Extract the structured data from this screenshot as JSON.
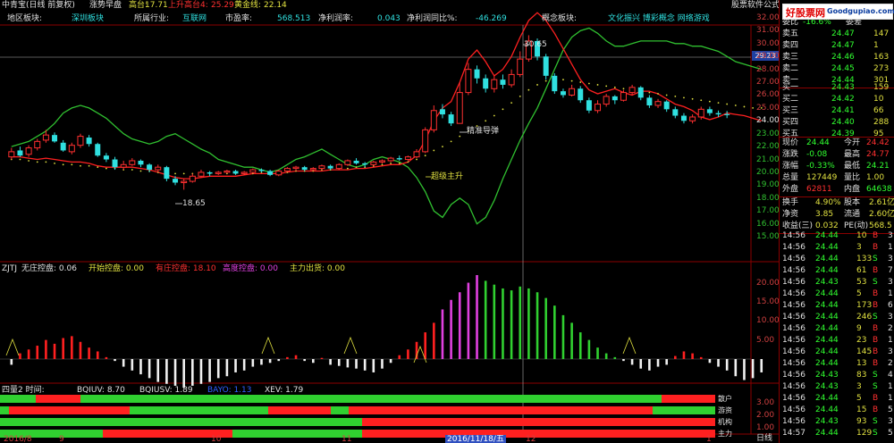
{
  "title_bar": {
    "name": "中青宝(日线 前复权)",
    "indicator": "涨势早盘",
    "gao_label": "高台:",
    "gao_value": "17.71",
    "up_label": "上升高台4:",
    "up_value": "25.29",
    "gold_label": "黄金线:",
    "gold_value": "22.14",
    "right_text": "股票软件公式"
  },
  "info_bar": {
    "region_label": "地区板块:",
    "region_value": "深圳板块",
    "industry_label": "所属行业:",
    "industry_value": "互联网",
    "pe_label": "市盈率:",
    "pe_value": "568.513",
    "margin_label": "净利润率:",
    "margin_value": "0.043",
    "growth_label": "净利润同比%:",
    "growth_value": "-46.269",
    "concept_label": "概念板块:",
    "concept_values": "文化振兴 博彩概念 网络游戏"
  },
  "main_chart": {
    "price_axis": [
      "32.00",
      "31.00",
      "30.00",
      "29.00",
      "28.00",
      "27.00",
      "26.00",
      "25.00",
      "24.00",
      "23.00",
      "22.00",
      "21.00",
      "20.00",
      "19.00",
      "18.00",
      "17.00",
      "16.00",
      "15.00"
    ],
    "annotations": {
      "high": "30.65",
      "low": "18.65",
      "precise": "精准导弹",
      "super": "超级主升"
    },
    "current_price_tag": "29.23"
  },
  "mid_indicator": {
    "label": "ZJTJ",
    "items": [
      {
        "label": "无庄控盘:",
        "value": "0.06",
        "color": "#e0e0e0"
      },
      {
        "label": "开始控盘:",
        "value": "0.00",
        "color": "#e0e040"
      },
      {
        "label": "有庄控盘:",
        "value": "18.10",
        "color": "#ff3030"
      },
      {
        "label": "高度控盘:",
        "value": "0.00",
        "color": "#e040e0"
      },
      {
        "label": "主力出货:",
        "value": "0.00",
        "color": "#e0e040"
      }
    ],
    "axis": [
      "20.00",
      "15.00",
      "10.00",
      "5.00"
    ]
  },
  "bottom_indicator": {
    "label": "四量2 时间:",
    "items": [
      {
        "label": "BQIUV:",
        "value": "8.70",
        "color": "#e0e0e0"
      },
      {
        "label": "BQIUSV:",
        "value": "1.89",
        "color": "#e0e0e0"
      },
      {
        "label": "BAYO:",
        "value": "1.13",
        "color": "#3060ff"
      },
      {
        "label": "XEV:",
        "value": "1.79",
        "color": "#e0e0e0"
      }
    ],
    "row_labels": [
      "散户",
      "游资",
      "机构",
      "主力"
    ],
    "axis": [
      "3.00",
      "2.00",
      "1.00"
    ]
  },
  "date_axis": {
    "labels": [
      "2016/8",
      "9",
      "10",
      "11",
      "2016/11/18/五",
      "12",
      "1"
    ],
    "corner": "日线"
  },
  "quote": {
    "header_label": "委比",
    "header_pct": "-16.6%",
    "header_diff": "委差",
    "sells": [
      {
        "label": "卖五",
        "price": "24.47",
        "vol": "147"
      },
      {
        "label": "卖四",
        "price": "24.47",
        "vol": "1"
      },
      {
        "label": "卖三",
        "price": "24.46",
        "vol": "163"
      },
      {
        "label": "卖二",
        "price": "24.45",
        "vol": "273"
      },
      {
        "label": "卖一",
        "price": "24.44",
        "vol": "301"
      }
    ],
    "buys": [
      {
        "label": "买一",
        "price": "24.43",
        "vol": "159"
      },
      {
        "label": "买二",
        "price": "24.42",
        "vol": "10"
      },
      {
        "label": "买三",
        "price": "24.41",
        "vol": "66"
      },
      {
        "label": "买四",
        "price": "24.40",
        "vol": "288"
      },
      {
        "label": "买五",
        "price": "24.39",
        "vol": "95"
      }
    ],
    "stats": [
      {
        "l1": "现价",
        "v1": "24.44",
        "l2": "今开",
        "v2": "24.42",
        "c1": "#30ff30",
        "c2": "#ff3030"
      },
      {
        "l1": "涨跌",
        "v1": "-0.08",
        "l2": "最高",
        "v2": "24.77",
        "c1": "#30ff30",
        "c2": "#ff3030"
      },
      {
        "l1": "涨幅",
        "v1": "-0.33%",
        "l2": "最低",
        "v2": "24.21",
        "c1": "#30ff30",
        "c2": "#30ff30"
      },
      {
        "l1": "总量",
        "v1": "127449",
        "l2": "量比",
        "v2": "1.00",
        "c1": "#e0e040",
        "c2": "#e0e040"
      },
      {
        "l1": "外盘",
        "v1": "62811",
        "l2": "内盘",
        "v2": "64638",
        "c1": "#ff3030",
        "c2": "#30ff30"
      }
    ],
    "stats2": [
      {
        "l1": "换手",
        "v1": "4.90%",
        "l2": "股本",
        "v2": "2.61亿"
      },
      {
        "l1": "净资",
        "v1": "3.85",
        "l2": "流通",
        "v2": "2.60亿"
      },
      {
        "l1": "收益(三)",
        "v1": "0.032",
        "l2": "PE(动)",
        "v2": "568.5"
      }
    ],
    "ticks": [
      {
        "time": "14:56",
        "price": "24.44",
        "vol": "10",
        "side": "B",
        "n": "3"
      },
      {
        "time": "14:56",
        "price": "24.44",
        "vol": "3",
        "side": "B",
        "n": "1"
      },
      {
        "time": "14:56",
        "price": "24.44",
        "vol": "133",
        "side": "S",
        "n": "3"
      },
      {
        "time": "14:56",
        "price": "24.44",
        "vol": "61",
        "side": "B",
        "n": "7"
      },
      {
        "time": "14:56",
        "price": "24.43",
        "vol": "53",
        "side": "S",
        "n": "3"
      },
      {
        "time": "14:56",
        "price": "24.44",
        "vol": "5",
        "side": "B",
        "n": "1"
      },
      {
        "time": "14:56",
        "price": "24.44",
        "vol": "173",
        "side": "B",
        "n": "6"
      },
      {
        "time": "14:56",
        "price": "24.44",
        "vol": "246",
        "side": "S",
        "n": "3"
      },
      {
        "time": "14:56",
        "price": "24.44",
        "vol": "9",
        "side": "B",
        "n": "2"
      },
      {
        "time": "14:56",
        "price": "24.44",
        "vol": "23",
        "side": "B",
        "n": "1"
      },
      {
        "time": "14:56",
        "price": "24.44",
        "vol": "145",
        "side": "B",
        "n": "3"
      },
      {
        "time": "14:56",
        "price": "24.44",
        "vol": "13",
        "side": "B",
        "n": "2"
      },
      {
        "time": "14:56",
        "price": "24.43",
        "vol": "83",
        "side": "S",
        "n": "4"
      },
      {
        "time": "14:56",
        "price": "24.43",
        "vol": "3",
        "side": "S",
        "n": "1"
      },
      {
        "time": "14:56",
        "price": "24.44",
        "vol": "5",
        "side": "B",
        "n": "1"
      },
      {
        "time": "14:56",
        "price": "24.44",
        "vol": "15",
        "side": "B",
        "n": "5"
      },
      {
        "time": "14:56",
        "price": "24.43",
        "vol": "93",
        "side": "S",
        "n": "3"
      },
      {
        "time": "14:57",
        "price": "24.44",
        "vol": "129",
        "side": "S",
        "n": "5"
      }
    ]
  },
  "logo": {
    "brand": "好股票网",
    "domain": "Goodgupiao.com"
  },
  "colors": {
    "up": "#ff3030",
    "down": "#30e0e0",
    "green": "#30c030",
    "yellow": "#e0e040",
    "magenta": "#e040e0"
  },
  "kline_series": {
    "candles": [
      {
        "o": 21.2,
        "c": 21.6,
        "h": 21.9,
        "l": 21.0
      },
      {
        "o": 21.7,
        "c": 21.3,
        "h": 22.0,
        "l": 21.2
      },
      {
        "o": 21.4,
        "c": 21.9,
        "h": 22.1,
        "l": 21.2
      },
      {
        "o": 21.9,
        "c": 22.4,
        "h": 22.6,
        "l": 21.7
      },
      {
        "o": 22.5,
        "c": 22.9,
        "h": 23.3,
        "l": 22.3
      },
      {
        "o": 22.9,
        "c": 22.4,
        "h": 23.1,
        "l": 22.3
      },
      {
        "o": 22.3,
        "c": 21.7,
        "h": 22.5,
        "l": 21.6
      },
      {
        "o": 21.6,
        "c": 22.1,
        "h": 22.3,
        "l": 21.4
      },
      {
        "o": 22.1,
        "c": 22.8,
        "h": 23.0,
        "l": 21.9
      },
      {
        "o": 22.7,
        "c": 22.2,
        "h": 22.9,
        "l": 22.0
      },
      {
        "o": 22.2,
        "c": 21.3,
        "h": 22.3,
        "l": 21.2
      },
      {
        "o": 21.3,
        "c": 21.0,
        "h": 21.5,
        "l": 20.8
      },
      {
        "o": 21.0,
        "c": 20.4,
        "h": 21.2,
        "l": 20.2
      },
      {
        "o": 20.4,
        "c": 20.6,
        "h": 20.9,
        "l": 20.2
      },
      {
        "o": 20.6,
        "c": 20.9,
        "h": 21.1,
        "l": 20.5
      },
      {
        "o": 20.9,
        "c": 20.6,
        "h": 21.0,
        "l": 20.4
      },
      {
        "o": 20.6,
        "c": 20.2,
        "h": 20.7,
        "l": 20.0
      },
      {
        "o": 20.2,
        "c": 20.4,
        "h": 20.6,
        "l": 20.0
      },
      {
        "o": 20.4,
        "c": 19.5,
        "h": 20.5,
        "l": 19.3
      },
      {
        "o": 19.5,
        "c": 19.2,
        "h": 19.7,
        "l": 19.0
      },
      {
        "o": 19.2,
        "c": 19.3,
        "h": 19.5,
        "l": 18.65
      },
      {
        "o": 19.3,
        "c": 19.7,
        "h": 19.9,
        "l": 19.2
      },
      {
        "o": 19.7,
        "c": 20.0,
        "h": 20.2,
        "l": 19.6
      },
      {
        "o": 20.0,
        "c": 19.9,
        "h": 20.1,
        "l": 19.7
      },
      {
        "o": 19.9,
        "c": 20.0,
        "h": 20.1,
        "l": 19.8
      },
      {
        "o": 20.0,
        "c": 20.1,
        "h": 20.2,
        "l": 19.9
      },
      {
        "o": 20.1,
        "c": 19.9,
        "h": 20.2,
        "l": 19.8
      },
      {
        "o": 19.9,
        "c": 20.0,
        "h": 20.1,
        "l": 19.8
      },
      {
        "o": 20.0,
        "c": 20.2,
        "h": 20.3,
        "l": 19.9
      },
      {
        "o": 20.2,
        "c": 20.1,
        "h": 20.3,
        "l": 20.0
      },
      {
        "o": 20.1,
        "c": 19.8,
        "h": 20.2,
        "l": 19.7
      },
      {
        "o": 19.8,
        "c": 20.1,
        "h": 20.2,
        "l": 19.7
      },
      {
        "o": 20.1,
        "c": 20.3,
        "h": 20.4,
        "l": 20.0
      },
      {
        "o": 20.3,
        "c": 20.4,
        "h": 20.5,
        "l": 20.1
      },
      {
        "o": 20.4,
        "c": 20.2,
        "h": 20.5,
        "l": 20.1
      },
      {
        "o": 20.2,
        "c": 20.3,
        "h": 20.4,
        "l": 20.1
      },
      {
        "o": 20.3,
        "c": 20.5,
        "h": 20.6,
        "l": 20.2
      },
      {
        "o": 20.5,
        "c": 20.3,
        "h": 20.6,
        "l": 20.2
      },
      {
        "o": 20.3,
        "c": 20.6,
        "h": 20.7,
        "l": 20.2
      },
      {
        "o": 20.6,
        "c": 20.9,
        "h": 21.0,
        "l": 20.5
      },
      {
        "o": 20.9,
        "c": 20.7,
        "h": 21.1,
        "l": 20.6
      },
      {
        "o": 20.7,
        "c": 20.6,
        "h": 20.8,
        "l": 20.4
      },
      {
        "o": 20.6,
        "c": 20.8,
        "h": 20.9,
        "l": 20.5
      },
      {
        "o": 20.8,
        "c": 20.9,
        "h": 21.0,
        "l": 20.7
      },
      {
        "o": 20.9,
        "c": 21.1,
        "h": 21.2,
        "l": 20.8
      },
      {
        "o": 21.1,
        "c": 21.0,
        "h": 21.3,
        "l": 20.9
      },
      {
        "o": 21.0,
        "c": 21.2,
        "h": 21.3,
        "l": 20.9
      },
      {
        "o": 21.2,
        "c": 21.6,
        "h": 21.8,
        "l": 21.1
      },
      {
        "o": 21.6,
        "c": 23.3,
        "h": 23.5,
        "l": 21.5
      },
      {
        "o": 23.3,
        "c": 24.8,
        "h": 25.2,
        "l": 23.1
      },
      {
        "o": 24.9,
        "c": 24.5,
        "h": 25.3,
        "l": 24.2
      },
      {
        "o": 24.5,
        "c": 23.8,
        "h": 24.7,
        "l": 23.6
      },
      {
        "o": 23.8,
        "c": 26.2,
        "h": 27.0,
        "l": 23.8
      },
      {
        "o": 26.2,
        "c": 28.0,
        "h": 28.5,
        "l": 26.0
      },
      {
        "o": 28.0,
        "c": 27.3,
        "h": 28.3,
        "l": 26.9
      },
      {
        "o": 27.3,
        "c": 26.5,
        "h": 27.6,
        "l": 26.2
      },
      {
        "o": 26.5,
        "c": 27.2,
        "h": 27.5,
        "l": 26.2
      },
      {
        "o": 27.2,
        "c": 26.8,
        "h": 27.6,
        "l": 26.5
      },
      {
        "o": 26.8,
        "c": 27.6,
        "h": 28.0,
        "l": 26.6
      },
      {
        "o": 27.6,
        "c": 28.8,
        "h": 29.4,
        "l": 27.4
      },
      {
        "o": 28.8,
        "c": 30.2,
        "h": 30.65,
        "l": 28.6
      },
      {
        "o": 30.2,
        "c": 29.0,
        "h": 30.4,
        "l": 28.7
      },
      {
        "o": 29.0,
        "c": 27.5,
        "h": 29.2,
        "l": 27.2
      },
      {
        "o": 27.5,
        "c": 26.3,
        "h": 27.7,
        "l": 26.1
      },
      {
        "o": 26.3,
        "c": 26.0,
        "h": 26.5,
        "l": 25.8
      },
      {
        "o": 26.0,
        "c": 26.5,
        "h": 26.8,
        "l": 25.9
      },
      {
        "o": 26.5,
        "c": 25.6,
        "h": 26.7,
        "l": 25.4
      },
      {
        "o": 25.6,
        "c": 24.8,
        "h": 25.8,
        "l": 24.6
      },
      {
        "o": 24.8,
        "c": 25.3,
        "h": 25.6,
        "l": 24.6
      },
      {
        "o": 25.3,
        "c": 25.9,
        "h": 26.1,
        "l": 25.1
      },
      {
        "o": 25.9,
        "c": 25.6,
        "h": 26.0,
        "l": 25.3
      },
      {
        "o": 25.6,
        "c": 26.2,
        "h": 26.4,
        "l": 25.5
      },
      {
        "o": 26.2,
        "c": 26.6,
        "h": 26.8,
        "l": 26.0
      },
      {
        "o": 26.6,
        "c": 25.8,
        "h": 26.7,
        "l": 25.6
      },
      {
        "o": 25.8,
        "c": 25.2,
        "h": 26.0,
        "l": 25.0
      },
      {
        "o": 25.2,
        "c": 25.5,
        "h": 25.7,
        "l": 25.0
      },
      {
        "o": 25.5,
        "c": 24.9,
        "h": 25.6,
        "l": 24.7
      },
      {
        "o": 24.9,
        "c": 24.4,
        "h": 25.1,
        "l": 24.2
      },
      {
        "o": 24.4,
        "c": 24.0,
        "h": 24.6,
        "l": 23.8
      },
      {
        "o": 24.0,
        "c": 24.3,
        "h": 24.5,
        "l": 23.8
      },
      {
        "o": 24.3,
        "c": 24.9,
        "h": 25.1,
        "l": 24.1
      },
      {
        "o": 24.9,
        "c": 24.6,
        "h": 25.1,
        "l": 24.4
      },
      {
        "o": 24.6,
        "c": 24.5,
        "h": 24.8,
        "l": 24.3
      },
      {
        "o": 24.52,
        "c": 24.44,
        "h": 24.77,
        "l": 24.21
      }
    ],
    "green_line": [
      22.0,
      22.2,
      22.4,
      22.8,
      23.2,
      23.8,
      24.6,
      25.0,
      25.2,
      25.0,
      24.6,
      24.2,
      23.6,
      23.0,
      22.6,
      22.4,
      22.2,
      22.4,
      22.8,
      23.0,
      22.6,
      22.2,
      21.8,
      21.5,
      21.0,
      20.8,
      20.6,
      20.4,
      20.4,
      20.2,
      20.0,
      20.2,
      20.6,
      21.0,
      21.2,
      21.5,
      21.8,
      21.4,
      21.0,
      20.6,
      20.4,
      20.6,
      21.0,
      21.2,
      21.0,
      20.8,
      20.4,
      19.6,
      18.5,
      17.0,
      16.5,
      17.5,
      18.0,
      17.5,
      16.0,
      16.5,
      17.8,
      19.5,
      21.0,
      22.5,
      23.8,
      25.0,
      26.5,
      28.0,
      29.5,
      30.5,
      31.0,
      31.2,
      30.8,
      30.2,
      29.8,
      29.8,
      30.0,
      30.2,
      30.2,
      30.2,
      30.2,
      30.0,
      30.0,
      29.8,
      29.8,
      29.6,
      29.4,
      29.0,
      28.6,
      28.4,
      28.2,
      28.0
    ],
    "red_line": [
      21.2,
      21.2,
      21.1,
      21.0,
      21.1,
      21.0,
      20.9,
      20.8,
      20.8,
      20.7,
      20.5,
      20.4,
      20.4,
      20.4,
      20.4,
      20.3,
      20.2,
      20.0,
      19.8,
      19.6,
      19.5,
      19.5,
      19.6,
      19.7,
      19.7,
      19.7,
      19.7,
      19.8,
      19.9,
      19.9,
      19.9,
      19.9,
      20.0,
      20.1,
      20.1,
      20.1,
      20.1,
      20.2,
      20.2,
      20.2,
      20.3,
      20.3,
      20.4,
      20.5,
      20.6,
      20.6,
      20.8,
      21.3,
      22.5,
      24.0,
      25.0,
      25.5,
      27.0,
      28.8,
      29.5,
      28.6,
      27.5,
      28.0,
      29.0,
      30.5,
      31.8,
      32.4,
      31.8,
      30.8,
      29.6,
      28.4,
      27.2,
      26.4,
      26.1,
      26.3,
      26.5,
      26.2,
      26.0,
      26.3,
      26.3,
      26.1,
      25.7,
      25.3,
      25.1,
      24.8,
      24.3,
      24.1,
      24.3,
      24.6,
      24.5,
      24.4,
      24.2,
      24.0
    ],
    "yellow_dots": [
      21.0,
      21.0,
      20.9,
      20.8,
      20.8,
      20.7,
      20.6,
      20.6,
      20.5,
      20.5,
      20.4,
      20.3,
      20.3,
      20.2,
      20.2,
      20.1,
      20.1,
      20.0,
      20.0,
      19.9,
      19.9,
      19.9,
      19.9,
      19.9,
      19.9,
      19.9,
      19.9,
      19.9,
      19.9,
      20.0,
      20.0,
      20.0,
      20.0,
      20.1,
      20.1,
      20.1,
      20.2,
      20.2,
      20.3,
      20.3,
      20.4,
      20.4,
      20.5,
      20.6,
      20.7,
      20.7,
      20.8,
      21.0,
      21.3,
      21.7,
      22.0,
      22.4,
      22.8,
      23.2,
      23.6,
      24.0,
      24.4,
      24.9,
      25.4,
      25.9,
      26.4,
      26.8,
      27.1,
      27.2,
      27.2,
      27.1,
      27.0,
      26.9,
      26.8,
      26.7,
      26.6,
      26.5,
      26.4,
      26.3,
      26.2,
      26.1,
      26.0,
      25.9,
      25.8,
      25.7,
      25.6,
      25.5,
      25.4,
      25.3,
      25.2,
      25.1,
      25.0,
      25.0
    ],
    "mid_bars": [
      -1.5,
      1.5,
      2.5,
      3.5,
      5.0,
      4.0,
      5.5,
      6.0,
      4.5,
      3.0,
      2.0,
      0.5,
      -0.5,
      -2.0,
      -3.0,
      -4.0,
      -5.0,
      -6.0,
      -6.5,
      -7.0,
      -7.5,
      -7.0,
      -6.5,
      -6.0,
      -5.0,
      -4.5,
      -3.5,
      -3.0,
      -2.0,
      -1.5,
      -1.0,
      -0.5,
      0.5,
      1.0,
      -0.5,
      -1.0,
      0.3,
      -1.5,
      -1.8,
      -2.2,
      -2.5,
      -3.0,
      -3.5,
      -2.5,
      -1.0,
      1.0,
      2.5,
      4.5,
      7.0,
      9.5,
      13.0,
      15.5,
      17.5,
      20.0,
      22.0,
      20.5,
      19.5,
      18.5,
      18.0,
      19.0,
      18.5,
      17.5,
      16.0,
      14.0,
      11.5,
      9.5,
      7.0,
      5.0,
      3.0,
      1.5,
      0.5,
      -0.5,
      -1.5,
      -2.5,
      -3.0,
      -2.0,
      -1.5,
      0.8,
      2.0,
      1.5,
      0.5,
      -1.0,
      -2.0,
      -3.0,
      -4.5,
      -5.5,
      -5.0,
      -3.5
    ]
  }
}
